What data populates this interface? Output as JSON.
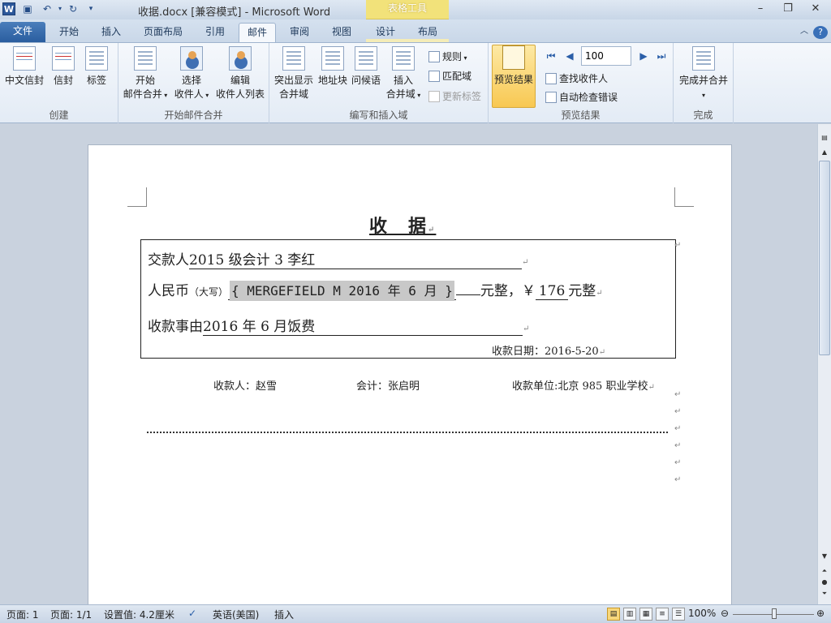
{
  "titlebar": {
    "title": "收据.docx [兼容模式] - Microsoft Word",
    "context_tab_group": "表格工具",
    "quick_access": [
      "save-icon",
      "undo-icon",
      "redo-icon",
      "customize-icon"
    ],
    "window_buttons": [
      "minimize",
      "restore",
      "close"
    ]
  },
  "tabs": [
    {
      "label": "文件"
    },
    {
      "label": "开始"
    },
    {
      "label": "插入"
    },
    {
      "label": "页面布局"
    },
    {
      "label": "引用"
    },
    {
      "label": "邮件",
      "active": true
    },
    {
      "label": "审阅"
    },
    {
      "label": "视图"
    },
    {
      "label": "设计"
    },
    {
      "label": "布局"
    }
  ],
  "ribbon": {
    "groups": {
      "create": "创建",
      "start_merge": "开始邮件合并",
      "write_insert": "编写和插入域",
      "preview": "预览结果",
      "finish": "完成"
    },
    "create": {
      "chinese_envelope": "中文信封",
      "envelope": "信封",
      "label": "标签"
    },
    "start_merge": {
      "start_line1": "开始",
      "start_line2": "邮件合并",
      "select_line1": "选择",
      "select_line2": "收件人",
      "edit_line1": "编辑",
      "edit_line2": "收件人列表"
    },
    "write_insert": {
      "highlight_line1": "突出显示",
      "highlight_line2": "合并域",
      "address_block": "地址块",
      "greeting": "问候语",
      "insert_line1": "插入",
      "insert_line2": "合并域",
      "rules": "规则",
      "match_fields": "匹配域",
      "update_labels": "更新标签"
    },
    "preview": {
      "preview_results": "预览结果",
      "record": "100",
      "find_recipient": "查找收件人",
      "auto_check": "自动检查错误"
    },
    "finish": {
      "finish_merge": "完成并合并"
    }
  },
  "document": {
    "title": "收　据",
    "row1_label": "交款人",
    "row1_value": " 2015 级会计 3  李红",
    "row2_label": "人民币",
    "row2_small": "（大写）",
    "row2_field": "{ MERGEFIELD M 2016 年 6 月 }",
    "row2_unit": "元整，￥",
    "row2_amount": " 176 ",
    "row2_unit2": "元整",
    "row3_label": "收款事由",
    "row3_value": " 2016 年 6 月饭费",
    "date_label": "收款日期：",
    "date_value": "2016-5-20",
    "payee": "收款人：赵雪",
    "accountant": "会计：张启明",
    "unit": "收款单位:北京 985 职业学校"
  },
  "statusbar": {
    "page": "页面: 1",
    "pages": "页面: 1/1",
    "setting": "设置值: 4.2厘米",
    "language": "英语(美国)",
    "mode": "插入",
    "zoom": "100%"
  }
}
